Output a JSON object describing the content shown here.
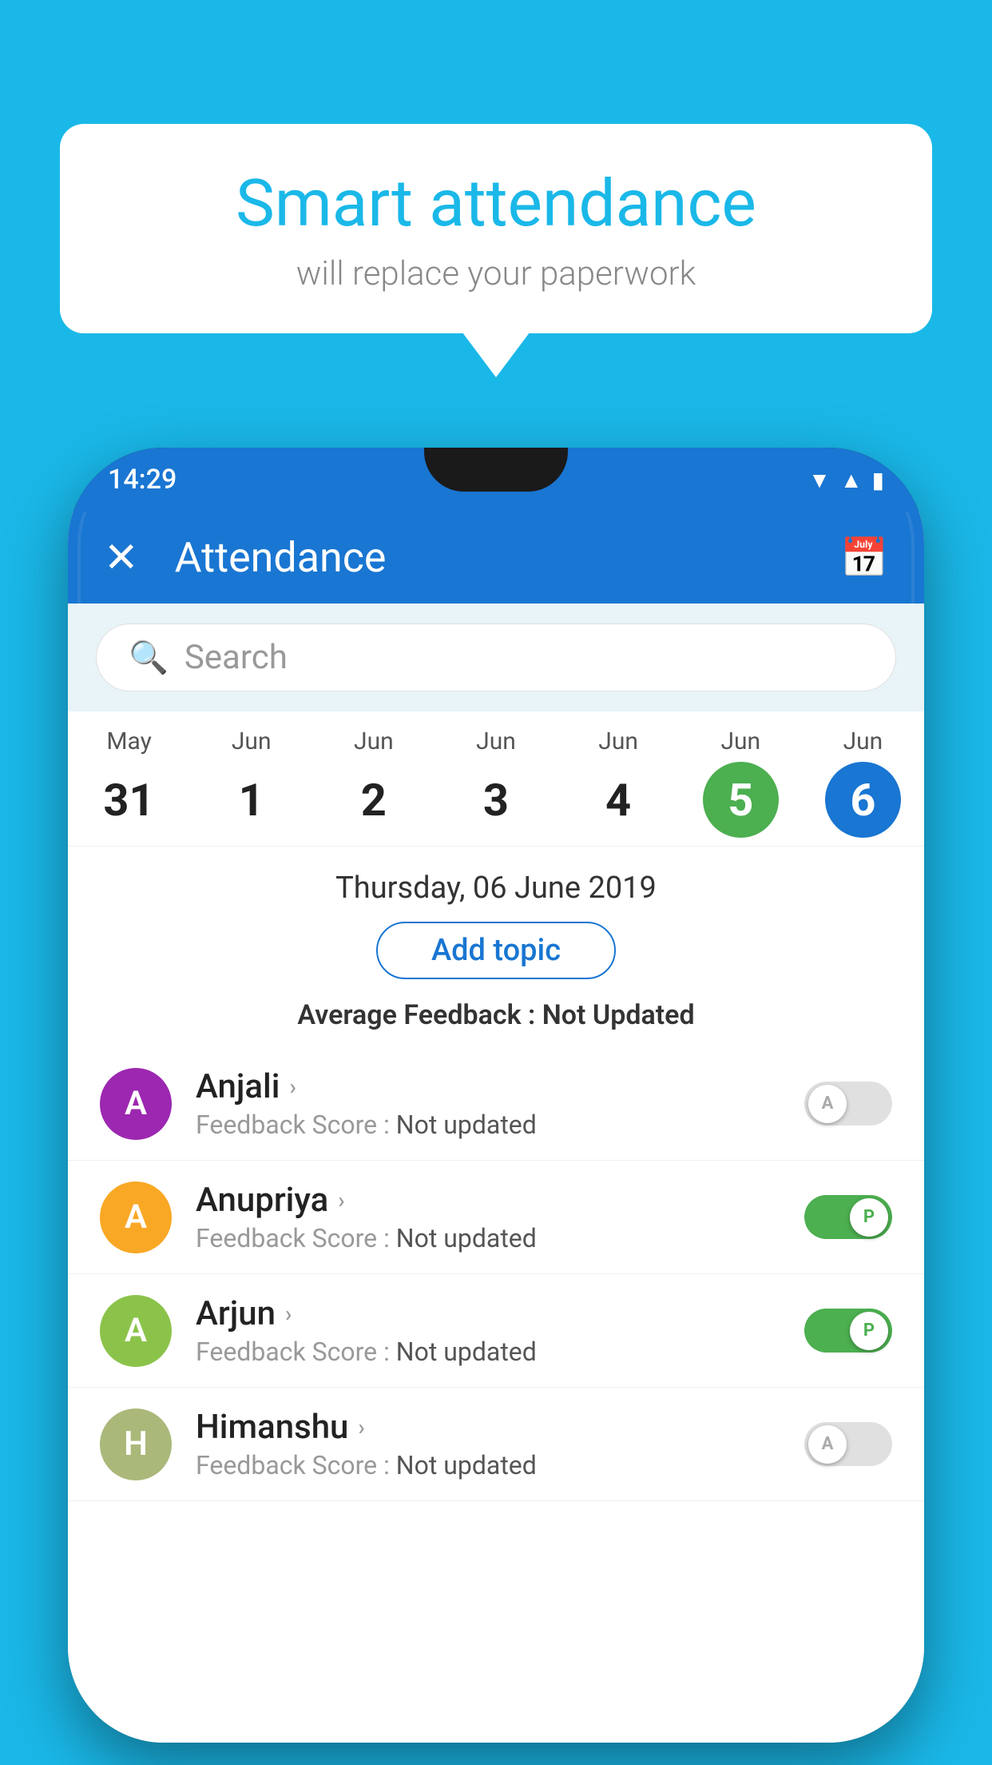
{
  "background": {
    "color": "#1ab8e8"
  },
  "speech_bubble": {
    "title": "Smart attendance",
    "subtitle": "will replace your paperwork"
  },
  "status_bar": {
    "time": "14:29",
    "icons": [
      "wifi",
      "signal",
      "battery"
    ]
  },
  "app_header": {
    "close_label": "✕",
    "title": "Attendance",
    "calendar_icon": "📅"
  },
  "search": {
    "placeholder": "Search"
  },
  "date_strip": {
    "dates": [
      {
        "month": "May",
        "day": "31",
        "style": "normal"
      },
      {
        "month": "Jun",
        "day": "1",
        "style": "normal"
      },
      {
        "month": "Jun",
        "day": "2",
        "style": "normal"
      },
      {
        "month": "Jun",
        "day": "3",
        "style": "normal"
      },
      {
        "month": "Jun",
        "day": "4",
        "style": "normal"
      },
      {
        "month": "Jun",
        "day": "5",
        "style": "green"
      },
      {
        "month": "Jun",
        "day": "6",
        "style": "blue"
      }
    ]
  },
  "selected_date": {
    "label": "Thursday, 06 June 2019"
  },
  "add_topic_button": {
    "label": "Add topic"
  },
  "avg_feedback": {
    "label": "Average Feedback : ",
    "value": "Not Updated"
  },
  "students": [
    {
      "name": "Anjali",
      "avatar_letter": "A",
      "avatar_color": "#9c27b0",
      "feedback_label": "Feedback Score : ",
      "feedback_value": "Not updated",
      "attendance": "off",
      "attendance_letter": "A"
    },
    {
      "name": "Anupriya",
      "avatar_letter": "A",
      "avatar_color": "#f9a825",
      "feedback_label": "Feedback Score : ",
      "feedback_value": "Not updated",
      "attendance": "on",
      "attendance_letter": "P"
    },
    {
      "name": "Arjun",
      "avatar_letter": "A",
      "avatar_color": "#8bc34a",
      "feedback_label": "Feedback Score : ",
      "feedback_value": "Not updated",
      "attendance": "on",
      "attendance_letter": "P"
    },
    {
      "name": "Himanshu",
      "avatar_letter": "H",
      "avatar_color": "#aab87a",
      "feedback_label": "Feedback Score : ",
      "feedback_value": "Not updated",
      "attendance": "off",
      "attendance_letter": "A"
    }
  ]
}
